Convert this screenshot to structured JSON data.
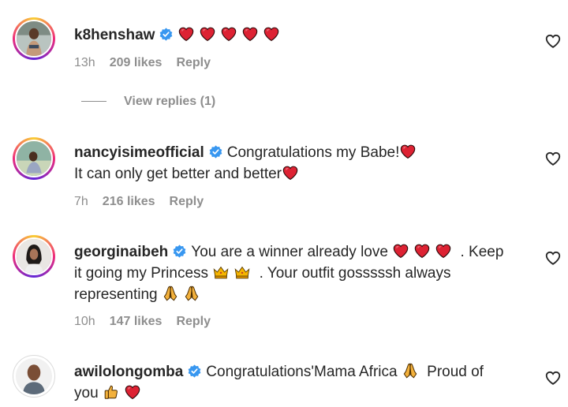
{
  "comments": [
    {
      "username": "k8henshaw",
      "text_lines": [
        ""
      ],
      "time": "13h",
      "likes": "209 likes",
      "reply": "Reply",
      "view_replies": "View replies (1)"
    },
    {
      "username": "nancyisimeofficial",
      "line1": "Congratulations my Babe!",
      "line2": "It can only get better and better",
      "time": "7h",
      "likes": "216 likes",
      "reply": "Reply"
    },
    {
      "username": "georginaibeh",
      "line1a": "You are a winner already love",
      "line1b": ". Keep",
      "line2a": "it going my Princess",
      "line2b": ". Your outfit gosssssh always",
      "line3": "representing",
      "time": "10h",
      "likes": "147 likes",
      "reply": "Reply"
    },
    {
      "username": "awilolongomba",
      "line1a": "Congratulations'Mama Africa",
      "line1b": "Proud of",
      "line2": "you"
    }
  ],
  "colors": {
    "verified": "#3897f0",
    "heart": "#e0245e",
    "meta": "#8e8e8e"
  },
  "icons": [
    "verified-badge-icon",
    "red-heart-emoji",
    "crown-emoji",
    "praying-emoji",
    "thumbs-up-emoji",
    "heart-outline-icon"
  ]
}
